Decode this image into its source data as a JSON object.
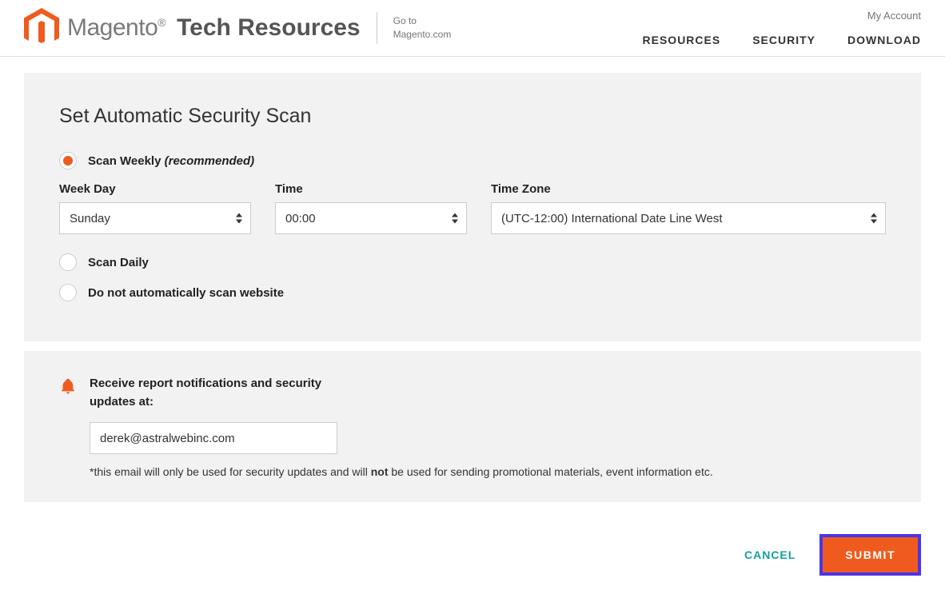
{
  "header": {
    "my_account": "My Account",
    "logo_brand": "Magento",
    "logo_section": "Tech Resources",
    "goto_line1": "Go to",
    "goto_line2": "Magento.com",
    "nav": [
      "RESOURCES",
      "SECURITY",
      "DOWNLOAD"
    ]
  },
  "scan_panel": {
    "title": "Set Automatic Security Scan",
    "options": {
      "weekly_label": "Scan Weekly ",
      "weekly_suffix": "(recommended)",
      "daily_label": "Scan Daily",
      "none_label": "Do not automatically scan website"
    },
    "fields": {
      "weekday_label": "Week Day",
      "weekday_value": "Sunday",
      "time_label": "Time",
      "time_value": "00:00",
      "timezone_label": "Time Zone",
      "timezone_value": "(UTC-12:00) International Date Line West"
    }
  },
  "notif": {
    "label": "Receive report notifications and security updates at:",
    "email_value": "derek@astralwebinc.com",
    "disclaimer_prefix": "*this email will only be used for security updates and will ",
    "disclaimer_bold": "not",
    "disclaimer_suffix": " be used for sending promotional materials, event information etc."
  },
  "actions": {
    "cancel": "CANCEL",
    "submit": "SUBMIT"
  }
}
